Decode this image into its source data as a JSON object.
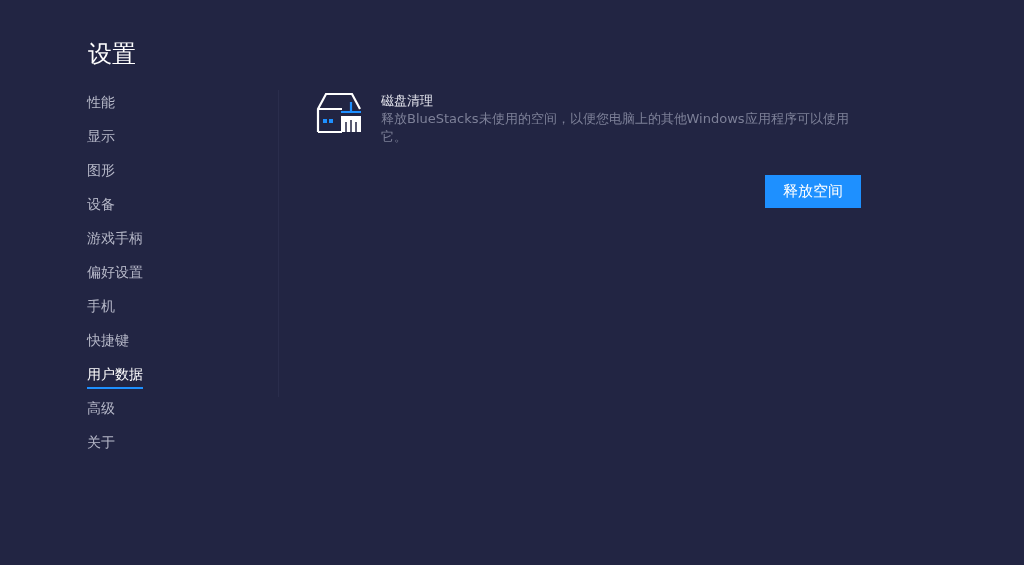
{
  "title": "设置",
  "sidebar": {
    "items": [
      {
        "label": "性能",
        "selected": false
      },
      {
        "label": "显示",
        "selected": false
      },
      {
        "label": "图形",
        "selected": false
      },
      {
        "label": "设备",
        "selected": false
      },
      {
        "label": "游戏手柄",
        "selected": false
      },
      {
        "label": "偏好设置",
        "selected": false
      },
      {
        "label": "手机",
        "selected": false
      },
      {
        "label": "快捷键",
        "selected": false
      },
      {
        "label": "用户数据",
        "selected": true
      },
      {
        "label": "高级",
        "selected": false
      },
      {
        "label": "关于",
        "selected": false
      }
    ]
  },
  "section": {
    "title": "磁盘清理",
    "description": "释放BlueStacks未使用的空间，以便您电脑上的其他Windows应用程序可以使用它。",
    "button": "释放空间"
  }
}
